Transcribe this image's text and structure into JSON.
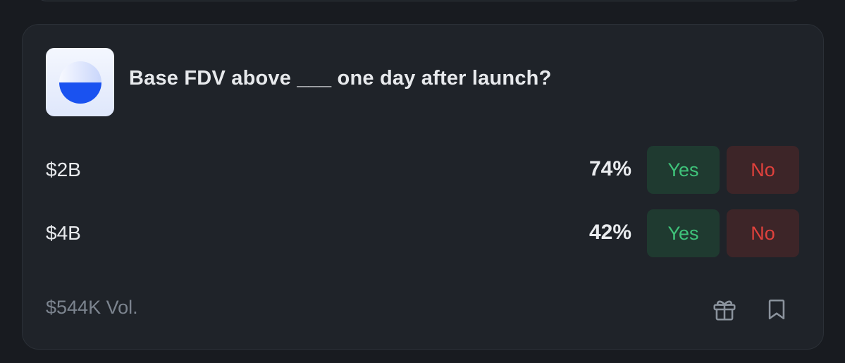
{
  "market": {
    "title": "Base FDV above ___ one day after launch?",
    "logo_icon": "base-logo-icon",
    "outcomes": [
      {
        "label": "$2B",
        "percent": "74%",
        "yes_label": "Yes",
        "no_label": "No"
      },
      {
        "label": "$4B",
        "percent": "42%",
        "yes_label": "Yes",
        "no_label": "No"
      }
    ],
    "volume": "$544K Vol.",
    "actions": {
      "gift_icon": "gift-icon",
      "bookmark_icon": "bookmark-icon"
    }
  },
  "colors": {
    "background": "#181b20",
    "card": "#1f2329",
    "yes_bg": "#1f3a30",
    "yes_text": "#3fc37a",
    "no_bg": "#3d2528",
    "no_text": "#e0413c",
    "logo_blue": "#1a52f0"
  }
}
